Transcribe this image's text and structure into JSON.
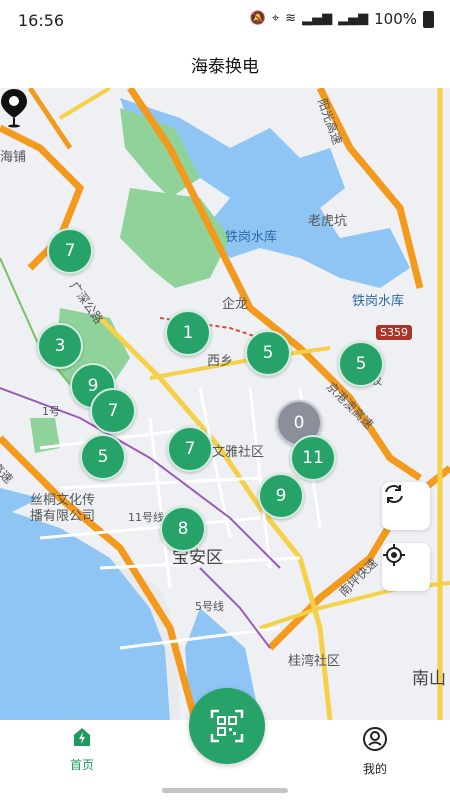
{
  "status_bar": {
    "time": "16:56",
    "battery": "100%"
  },
  "header": {
    "title": "海泰换电"
  },
  "map": {
    "labels": {
      "haipu": "海铺",
      "jingang_lake": "铁岗水库",
      "laohukeng": "老虎坑",
      "qilong": "企龙",
      "jingang_lake2": "铁岗水库",
      "xixiang": "西乡",
      "wenya": "文雅社区",
      "silk": "丝桐文化传",
      "silk2": "播有限公司",
      "baoan": "宝安区",
      "guiwan": "桂湾社区",
      "nanshan": "南山",
      "line1": "1号",
      "line11": "11号线",
      "line5": "5号线",
      "guangming": "阳光高速",
      "jinggangao": "京港澳高速",
      "nanping": "南坪快速",
      "gaosu": "高速",
      "bin": "坂",
      "road": "广深公路"
    },
    "road_badge": "S359",
    "clusters": [
      {
        "count": "7"
      },
      {
        "count": "3"
      },
      {
        "count": "9"
      },
      {
        "count": "7"
      },
      {
        "count": "1"
      },
      {
        "count": "5"
      },
      {
        "count": "5"
      },
      {
        "count": "0"
      },
      {
        "count": "7"
      },
      {
        "count": "5"
      },
      {
        "count": "11"
      },
      {
        "count": "9"
      },
      {
        "count": "8"
      }
    ]
  },
  "tabs": {
    "home": "首页",
    "mine": "我的"
  },
  "colors": {
    "accent": "#27a36a",
    "water": "#8ec5f4",
    "park": "#8fd39b"
  }
}
